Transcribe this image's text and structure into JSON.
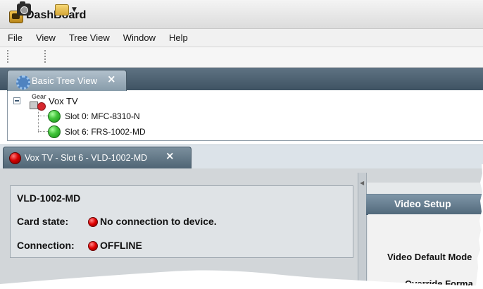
{
  "app": {
    "title": "DashBoard"
  },
  "menu": {
    "items": [
      "File",
      "View",
      "Tree View",
      "Window",
      "Help"
    ]
  },
  "toolbar": {
    "icons": [
      "camera-icon",
      "folder-icon",
      "dropdown-arrow-icon"
    ]
  },
  "tree_tab": {
    "label": "Basic Tree View",
    "close_glyph": "×"
  },
  "tree": {
    "root_label": "Vox TV",
    "gear_label": "Gear",
    "children": [
      {
        "label": "Slot 0: MFC-8310-N",
        "status_color": "#31b22e"
      },
      {
        "label": "Slot 6: FRS-1002-MD",
        "status_color": "#31b22e"
      }
    ]
  },
  "device_tab": {
    "label": "Vox TV - Slot 6 - VLD-1002-MD",
    "close_glyph": "×",
    "status_color": "#d40000"
  },
  "device": {
    "name": "VLD-1002-MD",
    "card_state_label": "Card state:",
    "card_state_value": "No connection to device.",
    "connection_label": "Connection:",
    "connection_value": "OFFLINE",
    "status_color": "#e10000"
  },
  "right_panel": {
    "title": "Video Setup",
    "line1": "Video Default Mode",
    "line2": "Override Forma"
  },
  "colors": {
    "tab_strip": "#4f6474",
    "panel_header": "#6f8799",
    "background": "#d2d6d9"
  }
}
